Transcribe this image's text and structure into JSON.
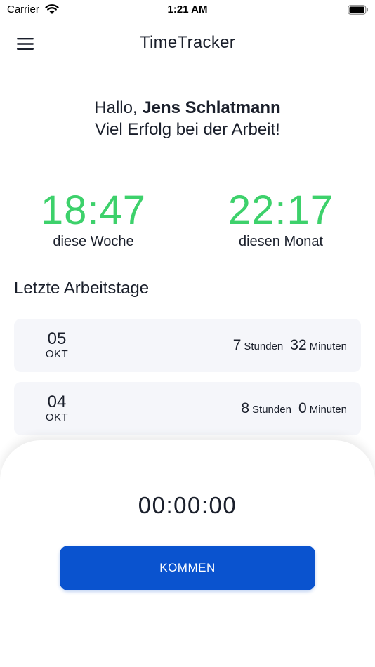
{
  "status_bar": {
    "carrier": "Carrier",
    "time": "1:21 AM"
  },
  "header": {
    "title": "TimeTracker",
    "menu_icon": "hamburger-menu-icon"
  },
  "greeting": {
    "prefix": "Hallo,",
    "name": "Jens Schlatmann",
    "message": "Viel Erfolg bei der Arbeit!"
  },
  "stats": [
    {
      "value": "18:47",
      "label": "diese Woche"
    },
    {
      "value": "22:17",
      "label": "diesen Monat"
    }
  ],
  "recent": {
    "title": "Letzte Arbeitstage",
    "days": [
      {
        "day": "05",
        "month": "OKT",
        "hours": "7",
        "hours_unit": "Stunden",
        "minutes": "32",
        "minutes_unit": "Minuten"
      },
      {
        "day": "04",
        "month": "OKT",
        "hours": "8",
        "hours_unit": "Stunden",
        "minutes": "0",
        "minutes_unit": "Minuten"
      }
    ]
  },
  "tracker": {
    "timer": "00:00:00",
    "button_label": "KOMMEN"
  },
  "colors": {
    "accent_green": "#3dd16b",
    "primary_blue": "#0a53cf",
    "card_background": "#f5f6fa",
    "text": "#1a1f2b"
  }
}
